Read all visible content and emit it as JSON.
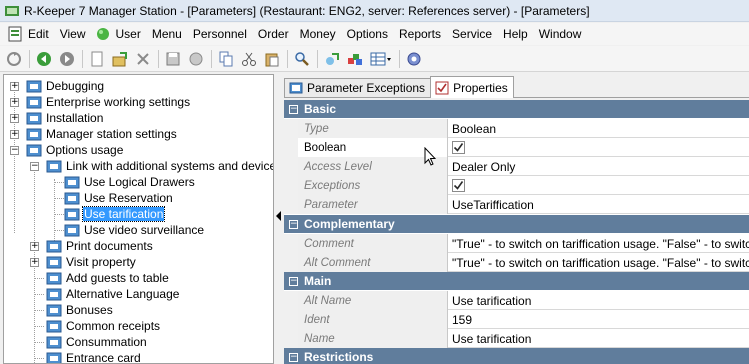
{
  "window": {
    "title": "R-Keeper 7 Manager Station - [Parameters] (Restaurant: ENG2, server: References server) - [Parameters]"
  },
  "menu": [
    "Edit",
    "View",
    "User",
    "Menu",
    "Personnel",
    "Order",
    "Money",
    "Options",
    "Reports",
    "Service",
    "Help",
    "Window"
  ],
  "tree": {
    "items": [
      {
        "label": "Debugging"
      },
      {
        "label": "Enterprise working settings"
      },
      {
        "label": "Installation"
      },
      {
        "label": "Manager station settings"
      },
      {
        "label": "Options usage"
      },
      {
        "label": "Link with additional systems and devices"
      },
      {
        "label": "Use Logical Drawers"
      },
      {
        "label": "Use Reservation"
      },
      {
        "label": "Use tarification"
      },
      {
        "label": "Use video surveillance"
      },
      {
        "label": "Print documents"
      },
      {
        "label": "Visit property"
      },
      {
        "label": "Add guests to table"
      },
      {
        "label": "Alternative Language"
      },
      {
        "label": "Bonuses"
      },
      {
        "label": "Common receipts"
      },
      {
        "label": "Consummation"
      },
      {
        "label": "Entrance card"
      }
    ]
  },
  "tabs": [
    {
      "label": "Parameter Exceptions"
    },
    {
      "label": "Properties"
    }
  ],
  "properties": {
    "sections": [
      {
        "title": "Basic",
        "rows": [
          {
            "name": "Type",
            "value": "Boolean"
          },
          {
            "name": "Boolean",
            "value": ""
          },
          {
            "name": "Access Level",
            "value": "Dealer Only"
          },
          {
            "name": "Exceptions",
            "value": ""
          },
          {
            "name": "Parameter",
            "value": "UseTariffication"
          }
        ]
      },
      {
        "title": "Complementary",
        "rows": [
          {
            "name": "Comment",
            "value": "\"True\" - to switch on tariffication usage. \"False\" - to switch off"
          },
          {
            "name": "Alt Comment",
            "value": "\"True\" - to switch on tariffication usage. \"False\" - to switch off"
          }
        ]
      },
      {
        "title": "Main",
        "rows": [
          {
            "name": "Alt Name",
            "value": "Use tarification"
          },
          {
            "name": "Ident",
            "value": "159"
          },
          {
            "name": "Name",
            "value": "Use tarification"
          }
        ]
      },
      {
        "title": "Restrictions",
        "rows": []
      }
    ]
  },
  "colors": {
    "section_header": "#607d9c",
    "selection": "#3399ff"
  }
}
